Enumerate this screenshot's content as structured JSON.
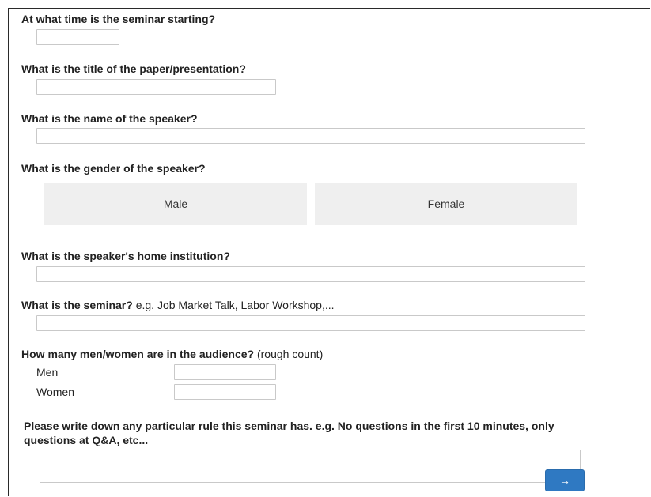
{
  "questions": {
    "start_time": {
      "label": "At what time is the seminar starting?"
    },
    "title": {
      "label": "What is the title of the paper/presentation?"
    },
    "speaker_name": {
      "label": "What is the name of the speaker?"
    },
    "gender": {
      "label": "What is the gender of the speaker?",
      "options": [
        "Male",
        "Female"
      ]
    },
    "institution": {
      "label": "What is the speaker's home institution?"
    },
    "seminar": {
      "label": "What is the seminar?",
      "hint": " e.g. Job Market Talk, Labor Workshop,..."
    },
    "audience": {
      "label": "How many men/women are in the audience?",
      "hint": " (rough count)",
      "men_label": "Men",
      "women_label": "Women"
    },
    "rules": {
      "label": "Please write down any particular rule this seminar has. e.g. No questions in the first 10 minutes, only questions at Q&A, etc..."
    }
  },
  "next_button": {
    "label": "→"
  },
  "colors": {
    "accent": "#2f79c2",
    "choice_bg": "#efefef",
    "border": "#c9c9c9"
  }
}
